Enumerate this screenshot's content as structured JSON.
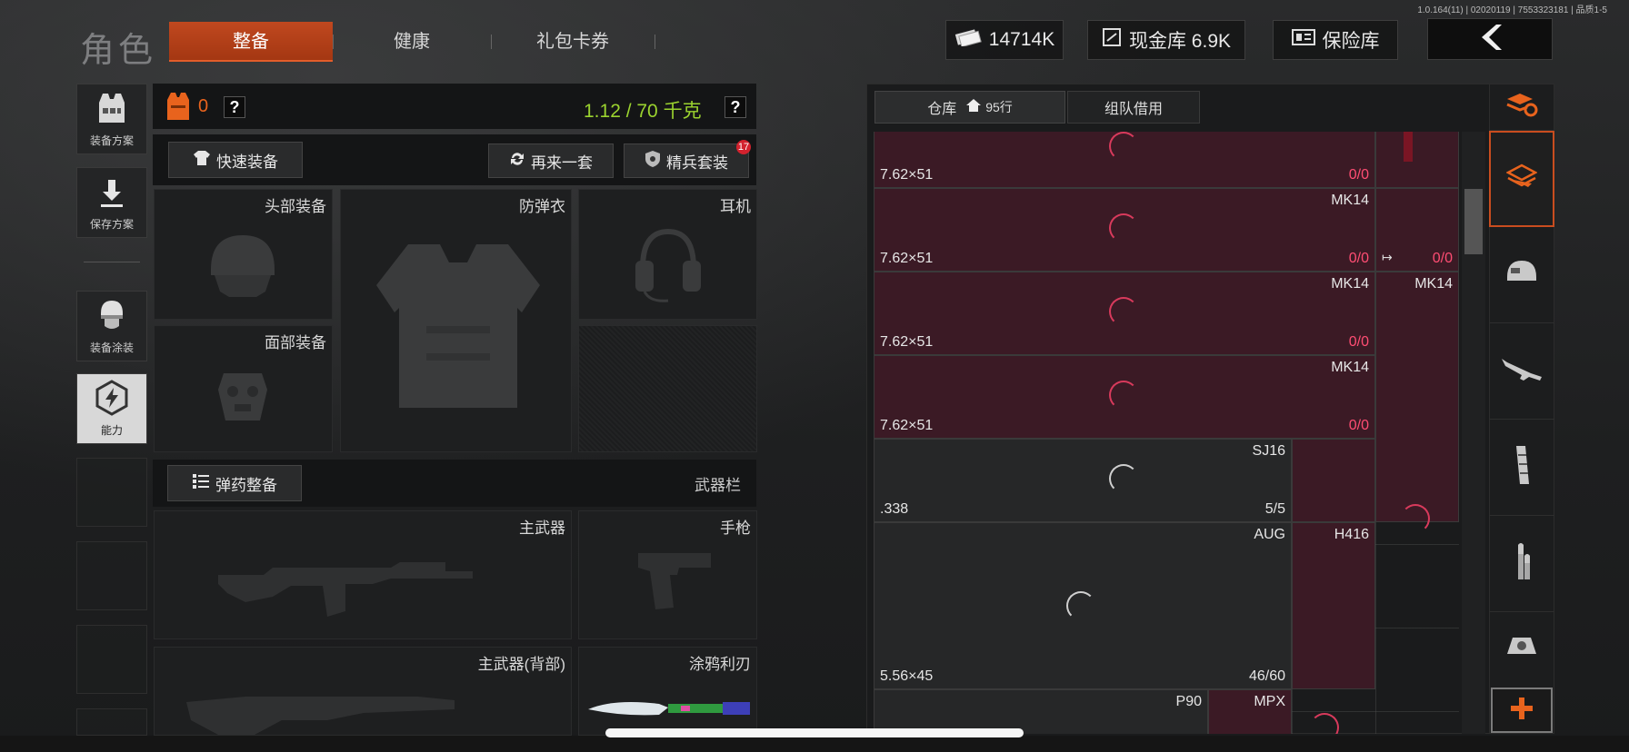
{
  "version": "1.0.164(11) | 02020119 | 7553323181 | 品质1-5",
  "header": {
    "title": "角色",
    "tabs": [
      {
        "label": "整备",
        "active": true
      },
      {
        "label": "健康",
        "active": false
      },
      {
        "label": "礼包卡券",
        "active": false
      }
    ],
    "money": "14714K",
    "cash_vault": "现金库 6.9K",
    "safe": "保险库"
  },
  "sidebar": {
    "items": [
      {
        "label": "装备方案",
        "icon": "vest-icon"
      },
      {
        "label": "保存方案",
        "icon": "download-icon"
      },
      {
        "label": "装备涂装",
        "icon": "helmet-paint-icon"
      },
      {
        "label": "能力",
        "icon": "ability-icon",
        "active": true
      }
    ]
  },
  "equip": {
    "armor_count": "0",
    "weight": "1.12 / 70 千克",
    "quick_equip": "快速装备",
    "again": "再来一套",
    "elite": "精兵套装",
    "elite_badge": "17",
    "slots": {
      "head": "头部装备",
      "armor": "防弹衣",
      "headset": "耳机",
      "face": "面部装备"
    },
    "ammo_btn": "弹药整备",
    "weapon_bar": "武器栏",
    "weapons": {
      "primary": "主武器",
      "pistol": "手枪",
      "primary_back": "主武器(背部)",
      "knife": "涂鸦利刃"
    }
  },
  "warehouse": {
    "tab_storage": "仓库",
    "rows": "95行",
    "tab_team": "组队借用",
    "items": [
      {
        "name": "",
        "caliber": "7.62×51",
        "count": "0/0",
        "color": "red"
      },
      {
        "name": "MK14",
        "caliber": "7.62×51",
        "count": "0/0",
        "color": "red"
      },
      {
        "name": "MK14",
        "caliber": "7.62×51",
        "count": "0/0",
        "color": "red"
      },
      {
        "name": "MK14",
        "caliber": "7.62×51",
        "count": "0/0",
        "color": "red"
      },
      {
        "name": "SJ16",
        "caliber": ".338",
        "count": "5/5",
        "color": "gray"
      },
      {
        "name": "AUG",
        "caliber": "5.56×45",
        "count": "46/60",
        "color": "gray"
      },
      {
        "name": "H416",
        "caliber": "",
        "count": "",
        "color": "red"
      },
      {
        "name": "P90",
        "caliber": "",
        "count": "",
        "color": "gray"
      },
      {
        "name": "MPX",
        "caliber": "",
        "count": "",
        "color": "red"
      }
    ],
    "side_items": [
      {
        "name": "",
        "count": "0/0"
      },
      {
        "name": "MK14",
        "count": ""
      }
    ]
  },
  "right_bar": [
    "sort-icon",
    "stack-icon",
    "helmet-icon",
    "rifle-icon",
    "magazine-icon",
    "ammo-icon",
    "scope-icon",
    "plus-icon"
  ],
  "colors": {
    "accent": "#c0481f",
    "weight_green": "#9bd32f",
    "red_item": "#3b1a25",
    "count_red": "#ff4d73"
  }
}
